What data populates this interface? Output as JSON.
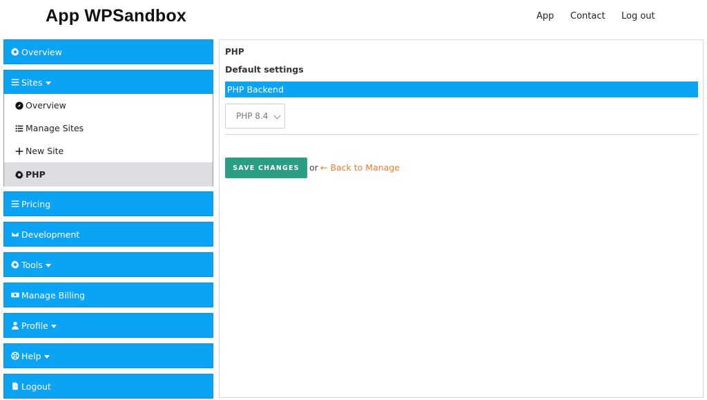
{
  "header": {
    "brand": "App WPSandbox",
    "nav": [
      {
        "label": "App"
      },
      {
        "label": "Contact"
      },
      {
        "label": "Log out"
      }
    ]
  },
  "sidebar": {
    "items": [
      {
        "label": "Overview",
        "icon": "gear-icon"
      },
      {
        "label": "Sites",
        "icon": "bars-icon",
        "has_caret": true
      },
      {
        "label": "Pricing",
        "icon": "bars-icon"
      },
      {
        "label": "Development",
        "icon": "envelope-icon"
      },
      {
        "label": "Tools",
        "icon": "gear-icon",
        "has_caret": true
      },
      {
        "label": "Manage Billing",
        "icon": "money-bill-icon"
      },
      {
        "label": "Profile",
        "icon": "user-icon",
        "has_caret": true
      },
      {
        "label": "Help",
        "icon": "life-ring-icon",
        "has_caret": true
      },
      {
        "label": "Logout",
        "icon": "door-icon"
      }
    ],
    "sites_submenu": [
      {
        "label": "Overview",
        "icon": "compass-icon"
      },
      {
        "label": "Manage Sites",
        "icon": "list-icon"
      },
      {
        "label": "New Site",
        "icon": "plus-icon"
      },
      {
        "label": "PHP",
        "icon": "gear-icon",
        "active": true
      }
    ]
  },
  "main": {
    "title": "PHP",
    "subtitle": "Default settings",
    "section_label": "PHP Backend",
    "php_version": {
      "selected": "PHP 8.4"
    },
    "save_label": "SAVE CHANGES",
    "or_text": "or",
    "back_link": "← Back to Manage"
  },
  "colors": {
    "accent": "#0ba3f3",
    "save_button": "#2a9d84",
    "link": "#f07b2f",
    "active_item_bg": "#dcdde1"
  }
}
